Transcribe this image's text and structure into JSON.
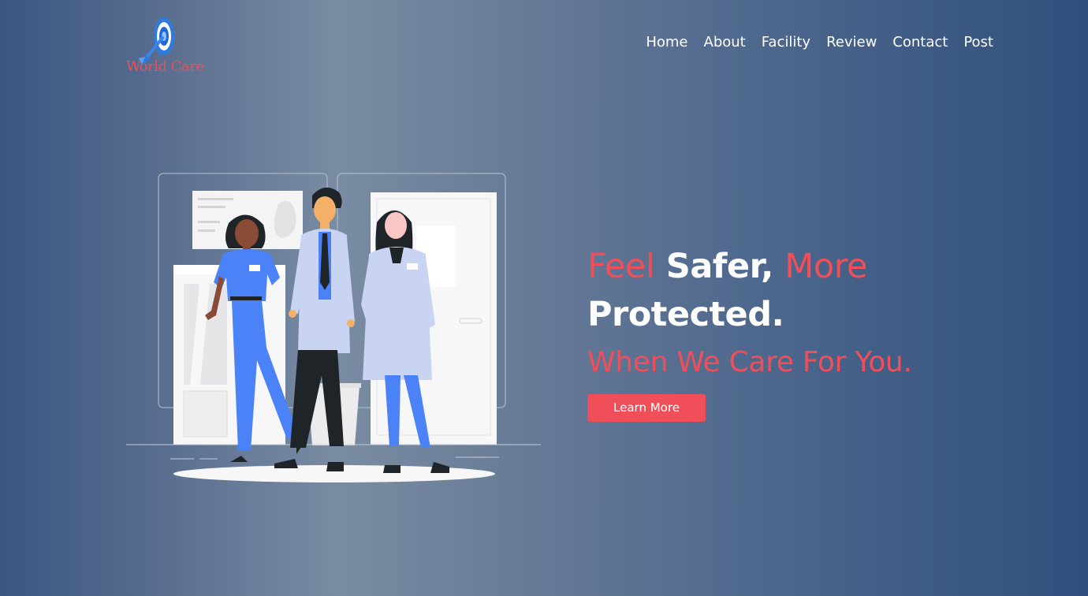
{
  "brand": {
    "logo_text": "World Care",
    "logo_icon": "target-arrow-icon",
    "color": "#e8505b"
  },
  "nav": {
    "items": [
      {
        "label": "Home"
      },
      {
        "label": "About"
      },
      {
        "label": "Facility"
      },
      {
        "label": "Review"
      },
      {
        "label": "Contact"
      },
      {
        "label": "Post"
      }
    ]
  },
  "hero": {
    "illustration": "medical-team-illustration",
    "headline": {
      "part1": "Feel",
      "part2": " Safer, ",
      "part3": "More",
      "part4": "Protected."
    },
    "subheadline": "When We Care For You.",
    "cta_label": "Learn More"
  },
  "colors": {
    "accent": "#f04f59",
    "text": "#ffffff",
    "background_dark": "#2f4f7c",
    "background_light": "#7a8ca3"
  }
}
